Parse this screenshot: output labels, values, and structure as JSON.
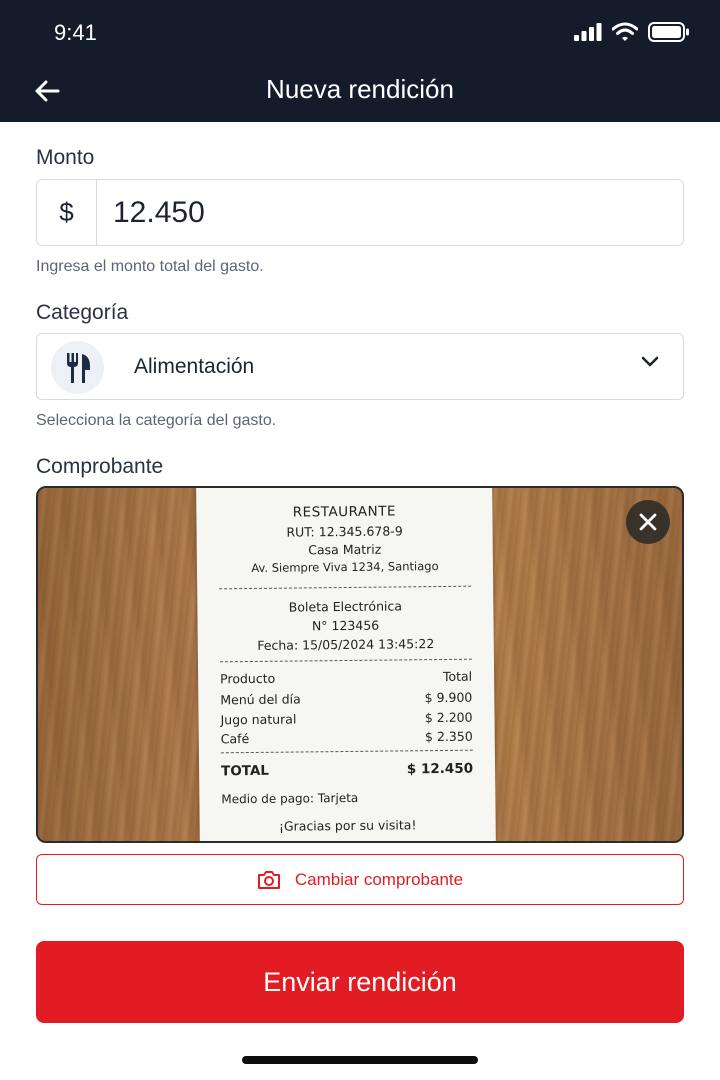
{
  "status_bar": {
    "time": "9:41"
  },
  "header": {
    "title": "Nueva rendición"
  },
  "amount": {
    "label": "Monto",
    "currency_symbol": "$",
    "value": "12.450",
    "helper": "Ingresa el monto total del gasto."
  },
  "category": {
    "label": "Categoría",
    "value": "Alimentación",
    "icon": "fork-knife-icon",
    "helper": "Selecciona la categoría del gasto."
  },
  "receipt": {
    "label": "Comprobante",
    "image": {
      "title": "RESTAURANTE",
      "rut": "RUT: 12.345.678-9",
      "branch": "Casa Matriz",
      "address": "Av. Siempre Viva 1234, Santiago",
      "doc_type": "Boleta Electrónica",
      "doc_number": "N° 123456",
      "date": "Fecha: 15/05/2024  13:45:22",
      "col_product": "Producto",
      "col_total": "Total",
      "items": [
        {
          "name": "Menú del día",
          "price": "$ 9.900"
        },
        {
          "name": "Jugo natural",
          "price": "$ 2.200"
        },
        {
          "name": "Café",
          "price": "$ 2.350"
        }
      ],
      "total_label": "TOTAL",
      "total_value": "$ 12.450",
      "payment": "Medio de pago: Tarjeta",
      "thanks": "¡Gracias por su visita!"
    },
    "change_button": "Cambiar comprobante"
  },
  "submit_button": "Enviar rendición",
  "colors": {
    "header_bg": "#141c2b",
    "accent_red": "#e31b23"
  }
}
